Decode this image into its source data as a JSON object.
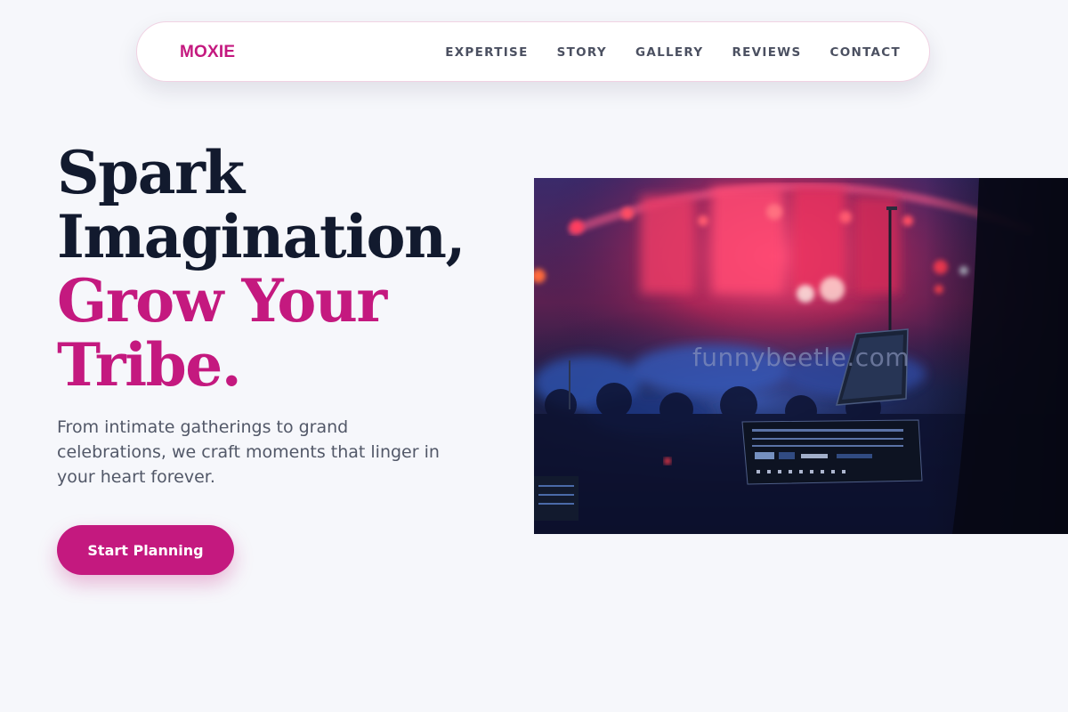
{
  "brand": "MOXIE",
  "nav": {
    "items": [
      {
        "label": "EXPERTISE"
      },
      {
        "label": "STORY"
      },
      {
        "label": "GALLERY"
      },
      {
        "label": "REVIEWS"
      },
      {
        "label": "CONTACT"
      }
    ]
  },
  "hero": {
    "title_lines": [
      "Spark",
      "Imagination,",
      "Grow Your",
      "Tribe."
    ],
    "subtitle": "From intimate gatherings to grand celebrations, we craft moments that linger in your heart forever.",
    "cta_label": "Start Planning",
    "image": {
      "description_icon": "concert-stage-photo",
      "watermark": "funnybeetle.com"
    }
  },
  "colors": {
    "accent": "#c4197f",
    "heading": "#121a2e",
    "body_text": "#525868",
    "nav_text": "#4b5061",
    "page_bg": "#f6f7fb"
  }
}
